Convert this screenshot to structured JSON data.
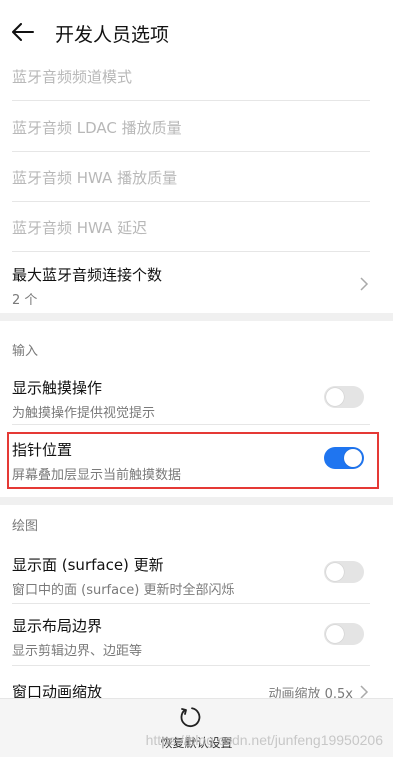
{
  "header": {
    "title": "开发人员选项",
    "back_icon": "arrow-left-icon"
  },
  "items": {
    "bt_channel_mode": {
      "title": "蓝牙音频频道模式"
    },
    "bt_ldac": {
      "title": "蓝牙音频 LDAC 播放质量"
    },
    "bt_hwa": {
      "title": "蓝牙音频 HWA 播放质量"
    },
    "bt_hwa_delay": {
      "title": "蓝牙音频 HWA 延迟"
    },
    "bt_max": {
      "title": "最大蓝牙音频连接个数",
      "subtitle": "2 个"
    }
  },
  "input_section": {
    "header": "输入",
    "show_touches": {
      "title": "显示触摸操作",
      "subtitle": "为触摸操作提供视觉提示",
      "enabled": false
    },
    "pointer_location": {
      "title": "指针位置",
      "subtitle": "屏幕叠加层显示当前触摸数据",
      "enabled": true
    }
  },
  "drawing_section": {
    "header": "绘图",
    "surface_updates": {
      "title": "显示面 (surface) 更新",
      "subtitle": "窗口中的面 (surface) 更新时全部闪烁",
      "enabled": false
    },
    "layout_bounds": {
      "title": "显示布局边界",
      "subtitle": "显示剪辑边界、边距等",
      "enabled": false
    },
    "window_anim": {
      "title": "窗口动画缩放",
      "value": "动画缩放 0.5x"
    }
  },
  "footer": {
    "reset_label": "恢复默认设置",
    "reset_icon": "reset-icon"
  },
  "watermark": "https://blog.csdn.net/junfeng19950206",
  "colors": {
    "switch_on": "#1f75f0",
    "highlight": "#e53935"
  }
}
